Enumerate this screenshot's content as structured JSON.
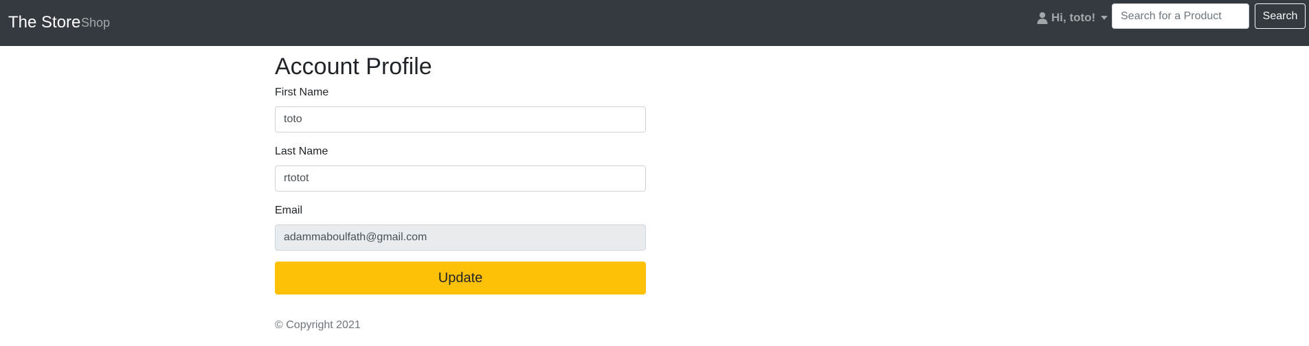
{
  "navbar": {
    "brand": "The Store",
    "shop_link": "Shop",
    "user_greeting": "Hi, toto!",
    "user_icon": "user-icon",
    "search": {
      "placeholder": "Search for a Product",
      "value": "",
      "button_label": "Search"
    }
  },
  "profile": {
    "title": "Account Profile",
    "first_name": {
      "label": "First Name",
      "value": "toto"
    },
    "last_name": {
      "label": "Last Name",
      "value": "rtotot"
    },
    "email": {
      "label": "Email",
      "value": "adammaboulfath@gmail.com"
    },
    "update_label": "Update"
  },
  "footer": {
    "copyright": "© Copyright 2021"
  },
  "colors": {
    "navbar_bg": "#343a40",
    "accent": "#ffc107",
    "readonly_bg": "#e9ecef"
  }
}
